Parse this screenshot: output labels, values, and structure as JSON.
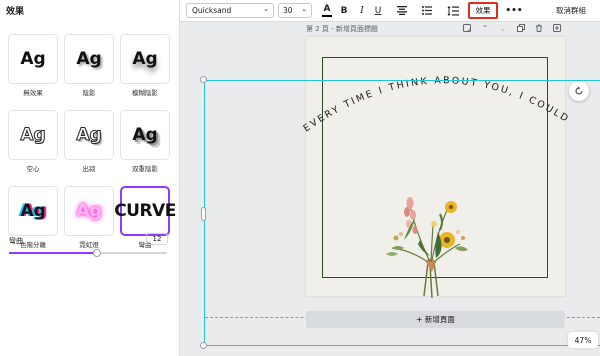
{
  "panel": {
    "title": "效果",
    "effects": [
      {
        "preview": "Ag",
        "label": "無效果",
        "style": "none"
      },
      {
        "preview": "Ag",
        "label": "陰影",
        "style": "shadow"
      },
      {
        "preview": "Ag",
        "label": "模糊陰影",
        "style": "lift"
      },
      {
        "preview": "Ag",
        "label": "空心",
        "style": "hollow"
      },
      {
        "preview": "Ag",
        "label": "出寂",
        "style": "splice"
      },
      {
        "preview": "Ag",
        "label": "双重陰影",
        "style": "echo"
      },
      {
        "preview": "Ag",
        "label": "色階分離",
        "style": "glitch"
      },
      {
        "preview": "Ag",
        "label": "霓虹燈",
        "style": "neon"
      },
      {
        "preview": "CURVE",
        "label": "彎曲",
        "style": "curve",
        "selected": true
      }
    ],
    "curve": {
      "label": "彎曲",
      "value": "12",
      "slider_fraction": 0.56
    },
    "accent_color": "#8b3dff"
  },
  "toolbar": {
    "font": "Quicksand",
    "size": "30",
    "color_icon": "A",
    "bold_icon": "B",
    "italic_icon": "I",
    "underline_icon": "U",
    "align_icon": "align-center-icon",
    "list_icon": "list-icon",
    "spacing_icon": "line-spacing-icon",
    "effects_label": "效果",
    "more_icon": "•••",
    "ungroup_label": "取消群組",
    "highlight_color": "#e12d1d"
  },
  "canvas": {
    "page_label": "第 2 頁 - 新增頁面標題",
    "curved_text": "EVERY TIME I THINK ABOUT YOU, I COULD",
    "add_page_label": "+ 新增頁面",
    "zoom": "47%",
    "selection_color": "#22c4d9",
    "frame_color": "#2f4a2a",
    "page_color": "#f1efe9"
  }
}
